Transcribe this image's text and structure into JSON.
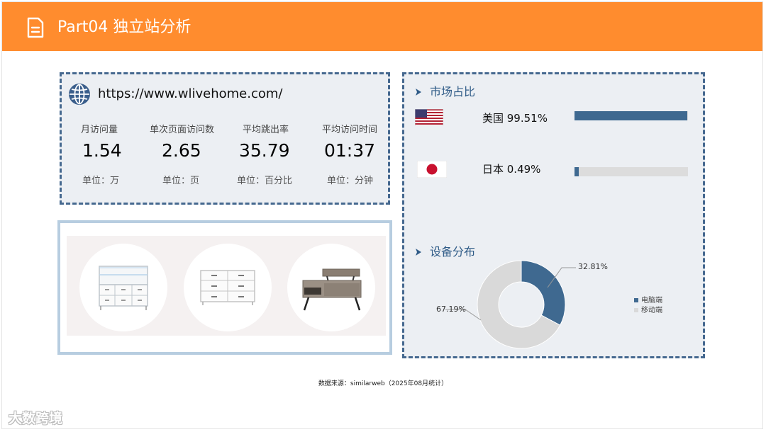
{
  "header": {
    "title": "Part04 独立站分析",
    "icon": "document-icon",
    "color": "#ff8c2e"
  },
  "site": {
    "url": "https://www.wlivehome.com/",
    "icon": "globe-icon",
    "metrics": [
      {
        "label": "月访问量",
        "value": "1.54",
        "unit": "单位：万"
      },
      {
        "label": "单次页面访问数",
        "value": "2.65",
        "unit": "单位：页"
      },
      {
        "label": "平均跳出率",
        "value": "35.79",
        "unit": "单位：百分比"
      },
      {
        "label": "平均访问时间",
        "value": "01:37",
        "unit": "单位：分钟"
      }
    ]
  },
  "products": {
    "items": [
      "tv-stand-product-image",
      "dresser-product-image",
      "lift-top-coffee-table-product-image"
    ]
  },
  "market": {
    "title": "市场占比",
    "countries": [
      {
        "label": "美国 99.51%",
        "flag": "us-flag-icon",
        "share": 99.51
      },
      {
        "label": "日本 0.49%",
        "flag": "japan-flag-icon",
        "share": 0.49
      }
    ]
  },
  "device": {
    "title": "设备分布",
    "chart_data": {
      "type": "pie",
      "categories": [
        "电脑端",
        "移动端"
      ],
      "values": [
        32.81,
        67.19
      ],
      "labels": [
        "32.81%",
        "67.19%"
      ],
      "colors": [
        "#3f6990",
        "#d9d9d9"
      ],
      "legend": "right"
    }
  },
  "footer": {
    "source": "数据来源：similarweb（2025年08月统计）",
    "watermark": "大数跨境"
  }
}
